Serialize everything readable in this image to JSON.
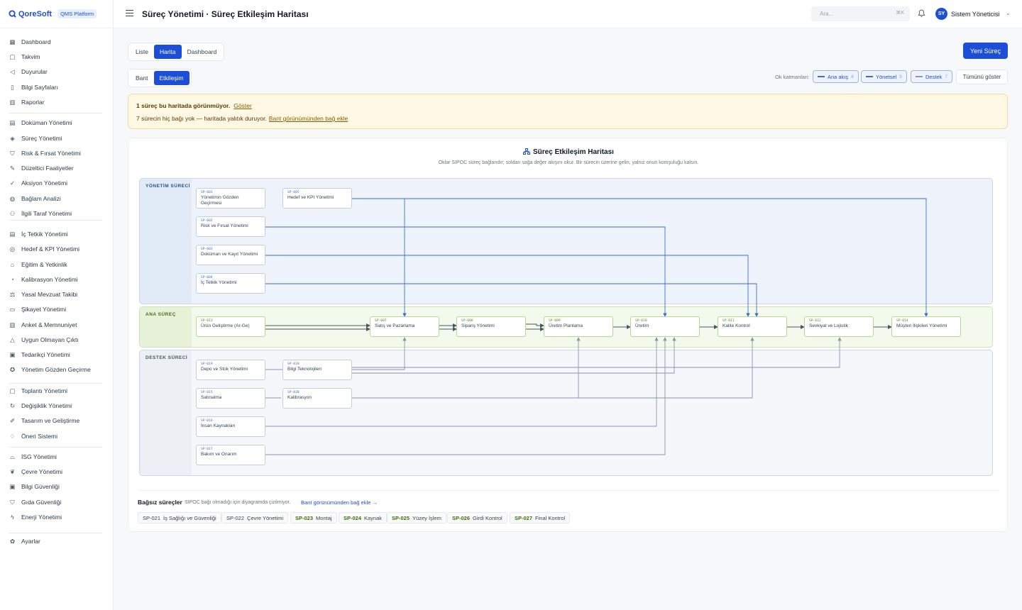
{
  "brand": {
    "name": "QoreSoft",
    "platform": "QMS Platform"
  },
  "header": {
    "title": "Süreç Yönetimi · Süreç Etkileşim Haritası",
    "search_placeholder": "Ara...",
    "search_shortcut": "⌘K",
    "user_initials": "SY",
    "user_name": "Sistem Yöneticisi"
  },
  "sidebar": {
    "items": [
      {
        "label": "Dashboard",
        "icon": "grid-icon"
      },
      {
        "label": "Takvim",
        "icon": "calendar-icon"
      },
      {
        "label": "Duyurular",
        "icon": "megaphone-icon"
      },
      {
        "label": "Bilgi Sayfaları",
        "icon": "book-icon"
      },
      {
        "label": "Raporlar",
        "icon": "chart-icon"
      },
      {
        "label": "Doküman Yönetimi",
        "icon": "document-icon"
      },
      {
        "label": "Süreç Yönetimi",
        "icon": "layers-icon"
      },
      {
        "label": "Risk & Fırsat Yönetimi",
        "icon": "shield-icon"
      },
      {
        "label": "Düzeltici Faaliyetler",
        "icon": "wrench-icon"
      },
      {
        "label": "Aksiyon Yönetimi",
        "icon": "check-circle-icon"
      },
      {
        "label": "Bağlam Analizi",
        "icon": "globe-icon"
      },
      {
        "label": "İlgili Taraf Yönetimi",
        "icon": "users-icon"
      },
      {
        "label": "İç Tetkik Yönetimi",
        "icon": "clipboard-icon"
      },
      {
        "label": "Hedef & KPI Yönetimi",
        "icon": "target-icon"
      },
      {
        "label": "Eğitim & Yetkinlik",
        "icon": "graduation-icon"
      },
      {
        "label": "Kalibrasyon Yönetimi",
        "icon": "gauge-icon"
      },
      {
        "label": "Yasal Mevzuat Takibi",
        "icon": "scale-icon"
      },
      {
        "label": "Şikayet Yönetimi",
        "icon": "message-icon"
      },
      {
        "label": "Anket & Memnuniyet",
        "icon": "bar-chart-icon"
      },
      {
        "label": "Uygun Olmayan Çıktı",
        "icon": "alert-icon"
      },
      {
        "label": "Tedarikçi Yönetimi",
        "icon": "truck-icon"
      },
      {
        "label": "Yönetim Gözden Geçirme",
        "icon": "badge-icon"
      },
      {
        "label": "Toplantı Yönetimi",
        "icon": "calendar-icon"
      },
      {
        "label": "Değişiklik Yönetimi",
        "icon": "refresh-icon"
      },
      {
        "label": "Tasarım ve Geliştirme",
        "icon": "pen-icon"
      },
      {
        "label": "Öneri Sistemi",
        "icon": "bulb-icon"
      },
      {
        "label": "İSG Yönetimi",
        "icon": "hard-hat-icon"
      },
      {
        "label": "Çevre Yönetimi",
        "icon": "leaf-icon"
      },
      {
        "label": "Bilgi Güvenliği",
        "icon": "lock-icon"
      },
      {
        "label": "Gıda Güvenliği",
        "icon": "shield-check-icon"
      },
      {
        "label": "Enerji Yönetimi",
        "icon": "bolt-icon"
      },
      {
        "label": "Ayarlar",
        "icon": "gear-icon"
      }
    ]
  },
  "tabs": {
    "view": [
      "Liste",
      "Harita",
      "Dashboard"
    ],
    "active_view": "Harita",
    "mode": [
      "Bant",
      "Etkileşim"
    ],
    "active_mode": "Etkileşim"
  },
  "actions": {
    "new_process": "Yeni Süreç"
  },
  "layers": {
    "label": "Ok katmanları:",
    "items": [
      {
        "label": "Ana akış",
        "count": "8"
      },
      {
        "label": "Yönetsel",
        "count": "5"
      },
      {
        "label": "Destek",
        "count": "7"
      }
    ],
    "show_all": "Tümünü göster"
  },
  "alert": {
    "line1_bold": "1 süreç bu haritada görünmüyor.",
    "line1_link": "Göster",
    "line2_text": "7 sürecin hiç bağı yok — haritada yalıtık duruyor.",
    "line2_link": "Bant görünümünden bağ ekle"
  },
  "map": {
    "title": "Süreç Etkileşim Haritası",
    "subtitle": "Oklar SIPOC süreç bağlarıdır; soldan sağa değer akışını okur. Bir sürecin üzerine gelin, yalnız onun komşuluğu kalsın.",
    "bands": {
      "management": "YÖNETİM SÜRECİ",
      "core": "ANA SÜREÇ",
      "support": "DESTEK SÜRECİ"
    },
    "nodes": {
      "sp001": {
        "code": "SP-001",
        "name": "Yönetimin Gözden Geçirmesi"
      },
      "sp005": {
        "code": "SP-005",
        "name": "Hedef ve KPI Yönetimi"
      },
      "sp002": {
        "code": "SP-002",
        "name": "Risk ve Fırsat Yönetimi"
      },
      "sp003": {
        "code": "SP-003",
        "name": "Doküman ve Kayıt Yönetimi"
      },
      "sp004": {
        "code": "SP-004",
        "name": "İç Tetkik Yönetimi"
      },
      "sp013": {
        "code": "SP-013",
        "name": "Ürün Geliştirme (Ar-Ge)"
      },
      "sp007": {
        "code": "SP-007",
        "name": "Satış ve Pazarlama"
      },
      "sp008": {
        "code": "SP-008",
        "name": "Sipariş Yönetimi"
      },
      "sp009": {
        "code": "SP-009",
        "name": "Üretim Planlama"
      },
      "sp010": {
        "code": "SP-010",
        "name": "Üretim"
      },
      "sp011": {
        "code": "SP-011",
        "name": "Kalite Kontrol"
      },
      "sp012": {
        "code": "SP-012",
        "name": "Sevkiyat ve Lojistik"
      },
      "sp014": {
        "code": "SP-014",
        "name": "Müşteri İlişkileri Yönetimi"
      },
      "sp019": {
        "code": "SP-019",
        "name": "Depo ve Stok Yönetimi"
      },
      "sp018": {
        "code": "SP-018",
        "name": "Bilgi Teknolojileri"
      },
      "sp015": {
        "code": "SP-015",
        "name": "Satınalma"
      },
      "sp020": {
        "code": "SP-020",
        "name": "Kalibrasyon"
      },
      "sp016": {
        "code": "SP-016",
        "name": "İnsan Kaynakları"
      },
      "sp017": {
        "code": "SP-017",
        "name": "Bakım ve Onarım"
      }
    }
  },
  "isolated": {
    "title": "Bağsız süreçler",
    "subtitle": "SIPOC bağı olmadığı için diyagramda çizilmiyor.",
    "link": "Bant görünümünden bağ ekle →",
    "items": [
      {
        "code": "SP-021",
        "name": "İş Sağlığı ve Güvenliği",
        "core": false
      },
      {
        "code": "SP-022",
        "name": "Çevre Yönetimi",
        "core": false
      },
      {
        "code": "SP-023",
        "name": "Montaj",
        "core": true
      },
      {
        "code": "SP-024",
        "name": "Kaynak",
        "core": true
      },
      {
        "code": "SP-025",
        "name": "Yüzey İşlem",
        "core": true
      },
      {
        "code": "SP-026",
        "name": "Girdi Kontrol",
        "core": true
      },
      {
        "code": "SP-027",
        "name": "Final Kontrol",
        "core": true
      }
    ]
  },
  "colors": {
    "accent": "#1d4ed8",
    "management_band": "#eef3fb",
    "core_band": "#f3f9ec",
    "support_band": "#f6f7fa",
    "arrow_management": "#3b6fcf",
    "arrow_main": "#4b5563",
    "arrow_support": "#8b96a8"
  }
}
